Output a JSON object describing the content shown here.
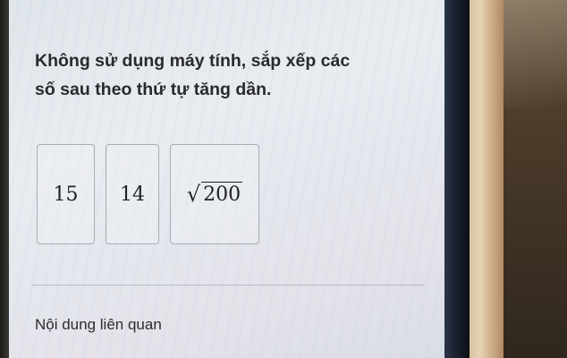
{
  "question": {
    "line1": "Không sử dụng máy tính, sắp xếp các",
    "line2": "số sau theo thứ tự tăng dần."
  },
  "answers": [
    {
      "label": "15"
    },
    {
      "label": "14"
    },
    {
      "radicand": "200"
    }
  ],
  "related_heading": "Nội dung liên quan"
}
